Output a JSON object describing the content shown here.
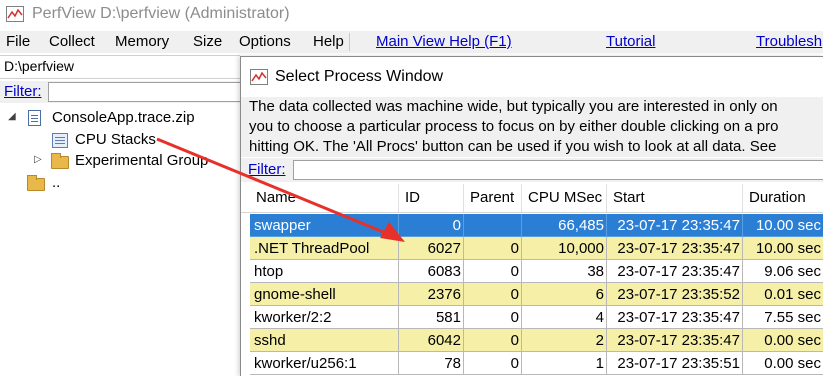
{
  "main": {
    "title": "PerfView D:\\perfview (Administrator)",
    "menu": [
      "File",
      "Collect",
      "Memory",
      "Size",
      "Options",
      "Help"
    ],
    "links": [
      "Main View Help (F1)",
      "Tutorial",
      "Troublesh"
    ],
    "path": "D:\\perfview",
    "filter_label": "Filter:",
    "tree": {
      "root": "ConsoleApp.trace.zip",
      "cpu_stacks": "CPU Stacks",
      "experimental": "Experimental Group",
      "parent_dir": ".."
    }
  },
  "dialog": {
    "title": "Select Process Window",
    "description": [
      "The data collected was machine wide, but typically you are interested in only on",
      "you to choose a particular process to focus on by either double clicking on a pro",
      "hitting OK. The 'All Procs' button can be used if you wish to look at all data. See"
    ],
    "filter_label": "Filter:",
    "columns": [
      "Name",
      "ID",
      "Parent",
      "CPU MSec",
      "Start",
      "Duration"
    ],
    "rows": [
      {
        "name": "swapper",
        "id": "0",
        "parent": "",
        "cpu": "66,485",
        "start": "23-07-17 23:35:47",
        "duration": "10.00 sec",
        "style": "sel"
      },
      {
        "name": ".NET ThreadPool",
        "id": "6027",
        "parent": "0",
        "cpu": "10,000",
        "start": "23-07-17 23:35:47",
        "duration": "10.00 sec",
        "style": "hl"
      },
      {
        "name": "htop",
        "id": "6083",
        "parent": "0",
        "cpu": "38",
        "start": "23-07-17 23:35:47",
        "duration": "9.06 sec",
        "style": "plain"
      },
      {
        "name": "gnome-shell",
        "id": "2376",
        "parent": "0",
        "cpu": "6",
        "start": "23-07-17 23:35:52",
        "duration": "0.01 sec",
        "style": "hl"
      },
      {
        "name": "kworker/2:2",
        "id": "581",
        "parent": "0",
        "cpu": "4",
        "start": "23-07-17 23:35:47",
        "duration": "7.55 sec",
        "style": "plain"
      },
      {
        "name": "sshd",
        "id": "6042",
        "parent": "0",
        "cpu": "2",
        "start": "23-07-17 23:35:47",
        "duration": "0.00 sec",
        "style": "hl"
      },
      {
        "name": "kworker/u256:1",
        "id": "78",
        "parent": "0",
        "cpu": "1",
        "start": "23-07-17 23:35:51",
        "duration": "0.00 sec",
        "style": "plain"
      }
    ]
  },
  "colors": {
    "selected_row": "#2a7fd4",
    "highlight_row": "#f5efa8",
    "link": "#0000cc",
    "annotation_arrow": "#e8302a"
  }
}
